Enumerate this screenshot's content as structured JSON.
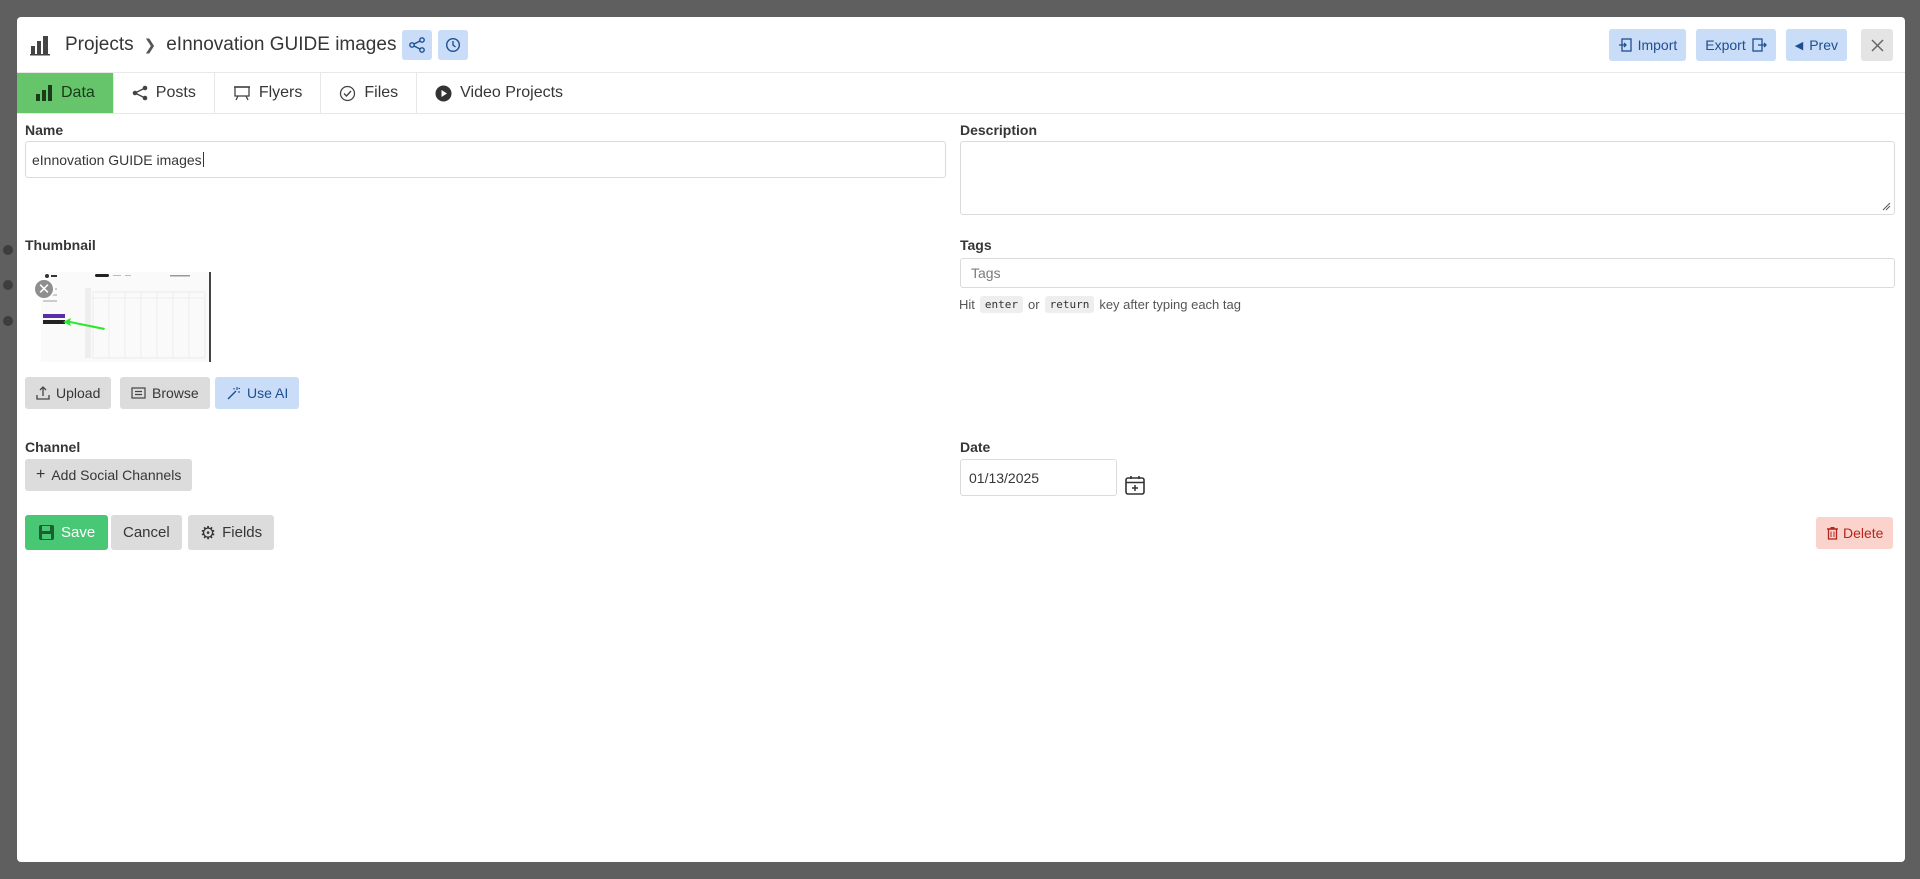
{
  "header": {
    "breadcrumb_root": "Projects",
    "title": "eInnovation GUIDE images",
    "actions": {
      "import_label": "Import",
      "export_label": "Export",
      "prev_label": "Prev"
    }
  },
  "tabs": [
    {
      "label": "Data",
      "icon": "chart-bar-icon",
      "active": true
    },
    {
      "label": "Posts",
      "icon": "share-icon"
    },
    {
      "label": "Flyers",
      "icon": "easel-icon"
    },
    {
      "label": "Files",
      "icon": "check-circle-icon"
    },
    {
      "label": "Video Projects",
      "icon": "play-circle-icon"
    }
  ],
  "form": {
    "name_label": "Name",
    "name_value": "eInnovation GUIDE images",
    "description_label": "Description",
    "description_value": "",
    "thumbnail_label": "Thumbnail",
    "thumbnail_actions": {
      "upload_label": "Upload",
      "browse_label": "Browse",
      "ai_label": "Use AI"
    },
    "tags_label": "Tags",
    "tags_placeholder": "Tags",
    "tags_help": {
      "prefix": "Hit",
      "key1": "enter",
      "or": "or",
      "key2": "return",
      "suffix": "key after typing each tag"
    },
    "channel_label": "Channel",
    "add_channels_label": "Add Social Channels",
    "date_label": "Date",
    "date_value": "01/13/2025"
  },
  "footer": {
    "save_label": "Save",
    "cancel_label": "Cancel",
    "fields_label": "Fields",
    "delete_label": "Delete"
  },
  "colors": {
    "accent_green": "#66c56a",
    "save_green": "#48c774",
    "info_blue": "#c9dcf8",
    "danger_light": "#fbd3cd"
  }
}
